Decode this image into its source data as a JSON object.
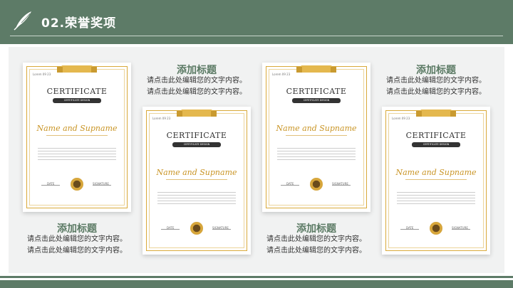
{
  "header": {
    "title": "02.荣誉奖项",
    "logo_icon": "quill-feather-icon"
  },
  "colors": {
    "brand_green": "#5d7b67",
    "gold": "#d9a93a"
  },
  "certificate": {
    "lorem_top": "Lorem 09 23",
    "title": "CERTIFICATE",
    "subtitle": "CERTIFICATE DESIGN",
    "name": "Name and Supname",
    "date_label": "DATE",
    "signature_label": "SIGNATURE"
  },
  "items": [
    {
      "title": "添加标题",
      "line1": "请点击此处编辑您的文字内容。",
      "line2": "请点击此处编辑您的文字内容。"
    },
    {
      "title": "添加标题",
      "line1": "请点击此处编辑您的文字内容。",
      "line2": "请点击此处编辑您的文字内容。"
    },
    {
      "title": "添加标题",
      "line1": "请点击此处编辑您的文字内容。",
      "line2": "请点击此处编辑您的文字内容。"
    },
    {
      "title": "添加标题",
      "line1": "请点击此处编辑您的文字内容。",
      "line2": "请点击此处编辑您的文字内容。"
    }
  ]
}
